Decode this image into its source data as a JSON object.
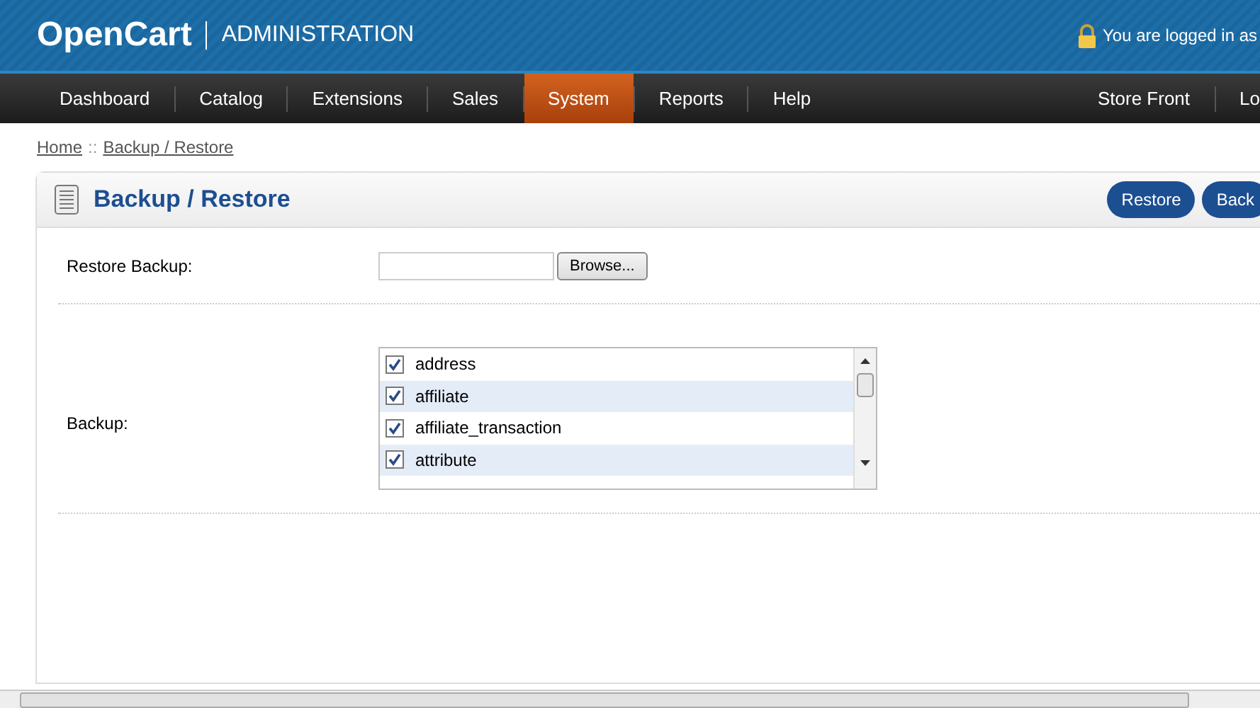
{
  "header": {
    "logo": "OpenCart",
    "subtitle": "ADMINISTRATION",
    "login_text": "You are logged in as"
  },
  "nav": {
    "left": [
      {
        "label": "Dashboard",
        "selected": false
      },
      {
        "label": "Catalog",
        "selected": false
      },
      {
        "label": "Extensions",
        "selected": false
      },
      {
        "label": "Sales",
        "selected": false
      },
      {
        "label": "System",
        "selected": true
      },
      {
        "label": "Reports",
        "selected": false
      },
      {
        "label": "Help",
        "selected": false
      }
    ],
    "right": [
      "Store Front",
      "Lo"
    ]
  },
  "breadcrumb": [
    {
      "label": "Home"
    },
    {
      "label": "Backup / Restore"
    }
  ],
  "breadcrumb_separator": "::",
  "panel": {
    "title": "Backup / Restore",
    "buttons": [
      "Restore",
      "Back"
    ]
  },
  "form": {
    "restore_label": "Restore Backup:",
    "browse_button": "Browse...",
    "backup_label": "Backup:",
    "tables": [
      {
        "name": "address",
        "checked": true
      },
      {
        "name": "affiliate",
        "checked": true
      },
      {
        "name": "affiliate_transaction",
        "checked": true
      },
      {
        "name": "attribute",
        "checked": true
      }
    ]
  }
}
